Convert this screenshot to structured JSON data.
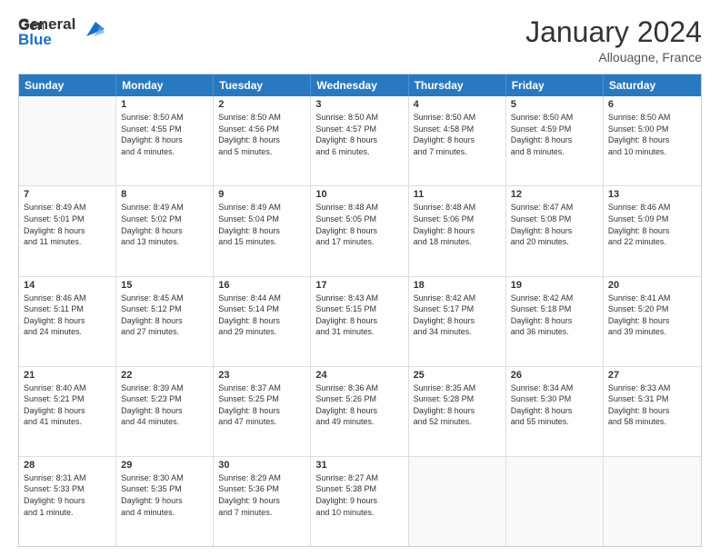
{
  "header": {
    "logo_general": "General",
    "logo_blue": "Blue",
    "main_title": "January 2024",
    "subtitle": "Allouagne, France"
  },
  "calendar": {
    "days_of_week": [
      "Sunday",
      "Monday",
      "Tuesday",
      "Wednesday",
      "Thursday",
      "Friday",
      "Saturday"
    ],
    "weeks": [
      [
        {
          "day": "",
          "info": []
        },
        {
          "day": "1",
          "info": [
            "Sunrise: 8:50 AM",
            "Sunset: 4:55 PM",
            "Daylight: 8 hours",
            "and 4 minutes."
          ]
        },
        {
          "day": "2",
          "info": [
            "Sunrise: 8:50 AM",
            "Sunset: 4:56 PM",
            "Daylight: 8 hours",
            "and 5 minutes."
          ]
        },
        {
          "day": "3",
          "info": [
            "Sunrise: 8:50 AM",
            "Sunset: 4:57 PM",
            "Daylight: 8 hours",
            "and 6 minutes."
          ]
        },
        {
          "day": "4",
          "info": [
            "Sunrise: 8:50 AM",
            "Sunset: 4:58 PM",
            "Daylight: 8 hours",
            "and 7 minutes."
          ]
        },
        {
          "day": "5",
          "info": [
            "Sunrise: 8:50 AM",
            "Sunset: 4:59 PM",
            "Daylight: 8 hours",
            "and 8 minutes."
          ]
        },
        {
          "day": "6",
          "info": [
            "Sunrise: 8:50 AM",
            "Sunset: 5:00 PM",
            "Daylight: 8 hours",
            "and 10 minutes."
          ]
        }
      ],
      [
        {
          "day": "7",
          "info": [
            "Sunrise: 8:49 AM",
            "Sunset: 5:01 PM",
            "Daylight: 8 hours",
            "and 11 minutes."
          ]
        },
        {
          "day": "8",
          "info": [
            "Sunrise: 8:49 AM",
            "Sunset: 5:02 PM",
            "Daylight: 8 hours",
            "and 13 minutes."
          ]
        },
        {
          "day": "9",
          "info": [
            "Sunrise: 8:49 AM",
            "Sunset: 5:04 PM",
            "Daylight: 8 hours",
            "and 15 minutes."
          ]
        },
        {
          "day": "10",
          "info": [
            "Sunrise: 8:48 AM",
            "Sunset: 5:05 PM",
            "Daylight: 8 hours",
            "and 17 minutes."
          ]
        },
        {
          "day": "11",
          "info": [
            "Sunrise: 8:48 AM",
            "Sunset: 5:06 PM",
            "Daylight: 8 hours",
            "and 18 minutes."
          ]
        },
        {
          "day": "12",
          "info": [
            "Sunrise: 8:47 AM",
            "Sunset: 5:08 PM",
            "Daylight: 8 hours",
            "and 20 minutes."
          ]
        },
        {
          "day": "13",
          "info": [
            "Sunrise: 8:46 AM",
            "Sunset: 5:09 PM",
            "Daylight: 8 hours",
            "and 22 minutes."
          ]
        }
      ],
      [
        {
          "day": "14",
          "info": [
            "Sunrise: 8:46 AM",
            "Sunset: 5:11 PM",
            "Daylight: 8 hours",
            "and 24 minutes."
          ]
        },
        {
          "day": "15",
          "info": [
            "Sunrise: 8:45 AM",
            "Sunset: 5:12 PM",
            "Daylight: 8 hours",
            "and 27 minutes."
          ]
        },
        {
          "day": "16",
          "info": [
            "Sunrise: 8:44 AM",
            "Sunset: 5:14 PM",
            "Daylight: 8 hours",
            "and 29 minutes."
          ]
        },
        {
          "day": "17",
          "info": [
            "Sunrise: 8:43 AM",
            "Sunset: 5:15 PM",
            "Daylight: 8 hours",
            "and 31 minutes."
          ]
        },
        {
          "day": "18",
          "info": [
            "Sunrise: 8:42 AM",
            "Sunset: 5:17 PM",
            "Daylight: 8 hours",
            "and 34 minutes."
          ]
        },
        {
          "day": "19",
          "info": [
            "Sunrise: 8:42 AM",
            "Sunset: 5:18 PM",
            "Daylight: 8 hours",
            "and 36 minutes."
          ]
        },
        {
          "day": "20",
          "info": [
            "Sunrise: 8:41 AM",
            "Sunset: 5:20 PM",
            "Daylight: 8 hours",
            "and 39 minutes."
          ]
        }
      ],
      [
        {
          "day": "21",
          "info": [
            "Sunrise: 8:40 AM",
            "Sunset: 5:21 PM",
            "Daylight: 8 hours",
            "and 41 minutes."
          ]
        },
        {
          "day": "22",
          "info": [
            "Sunrise: 8:39 AM",
            "Sunset: 5:23 PM",
            "Daylight: 8 hours",
            "and 44 minutes."
          ]
        },
        {
          "day": "23",
          "info": [
            "Sunrise: 8:37 AM",
            "Sunset: 5:25 PM",
            "Daylight: 8 hours",
            "and 47 minutes."
          ]
        },
        {
          "day": "24",
          "info": [
            "Sunrise: 8:36 AM",
            "Sunset: 5:26 PM",
            "Daylight: 8 hours",
            "and 49 minutes."
          ]
        },
        {
          "day": "25",
          "info": [
            "Sunrise: 8:35 AM",
            "Sunset: 5:28 PM",
            "Daylight: 8 hours",
            "and 52 minutes."
          ]
        },
        {
          "day": "26",
          "info": [
            "Sunrise: 8:34 AM",
            "Sunset: 5:30 PM",
            "Daylight: 8 hours",
            "and 55 minutes."
          ]
        },
        {
          "day": "27",
          "info": [
            "Sunrise: 8:33 AM",
            "Sunset: 5:31 PM",
            "Daylight: 8 hours",
            "and 58 minutes."
          ]
        }
      ],
      [
        {
          "day": "28",
          "info": [
            "Sunrise: 8:31 AM",
            "Sunset: 5:33 PM",
            "Daylight: 9 hours",
            "and 1 minute."
          ]
        },
        {
          "day": "29",
          "info": [
            "Sunrise: 8:30 AM",
            "Sunset: 5:35 PM",
            "Daylight: 9 hours",
            "and 4 minutes."
          ]
        },
        {
          "day": "30",
          "info": [
            "Sunrise: 8:29 AM",
            "Sunset: 5:36 PM",
            "Daylight: 9 hours",
            "and 7 minutes."
          ]
        },
        {
          "day": "31",
          "info": [
            "Sunrise: 8:27 AM",
            "Sunset: 5:38 PM",
            "Daylight: 9 hours",
            "and 10 minutes."
          ]
        },
        {
          "day": "",
          "info": []
        },
        {
          "day": "",
          "info": []
        },
        {
          "day": "",
          "info": []
        }
      ]
    ]
  }
}
